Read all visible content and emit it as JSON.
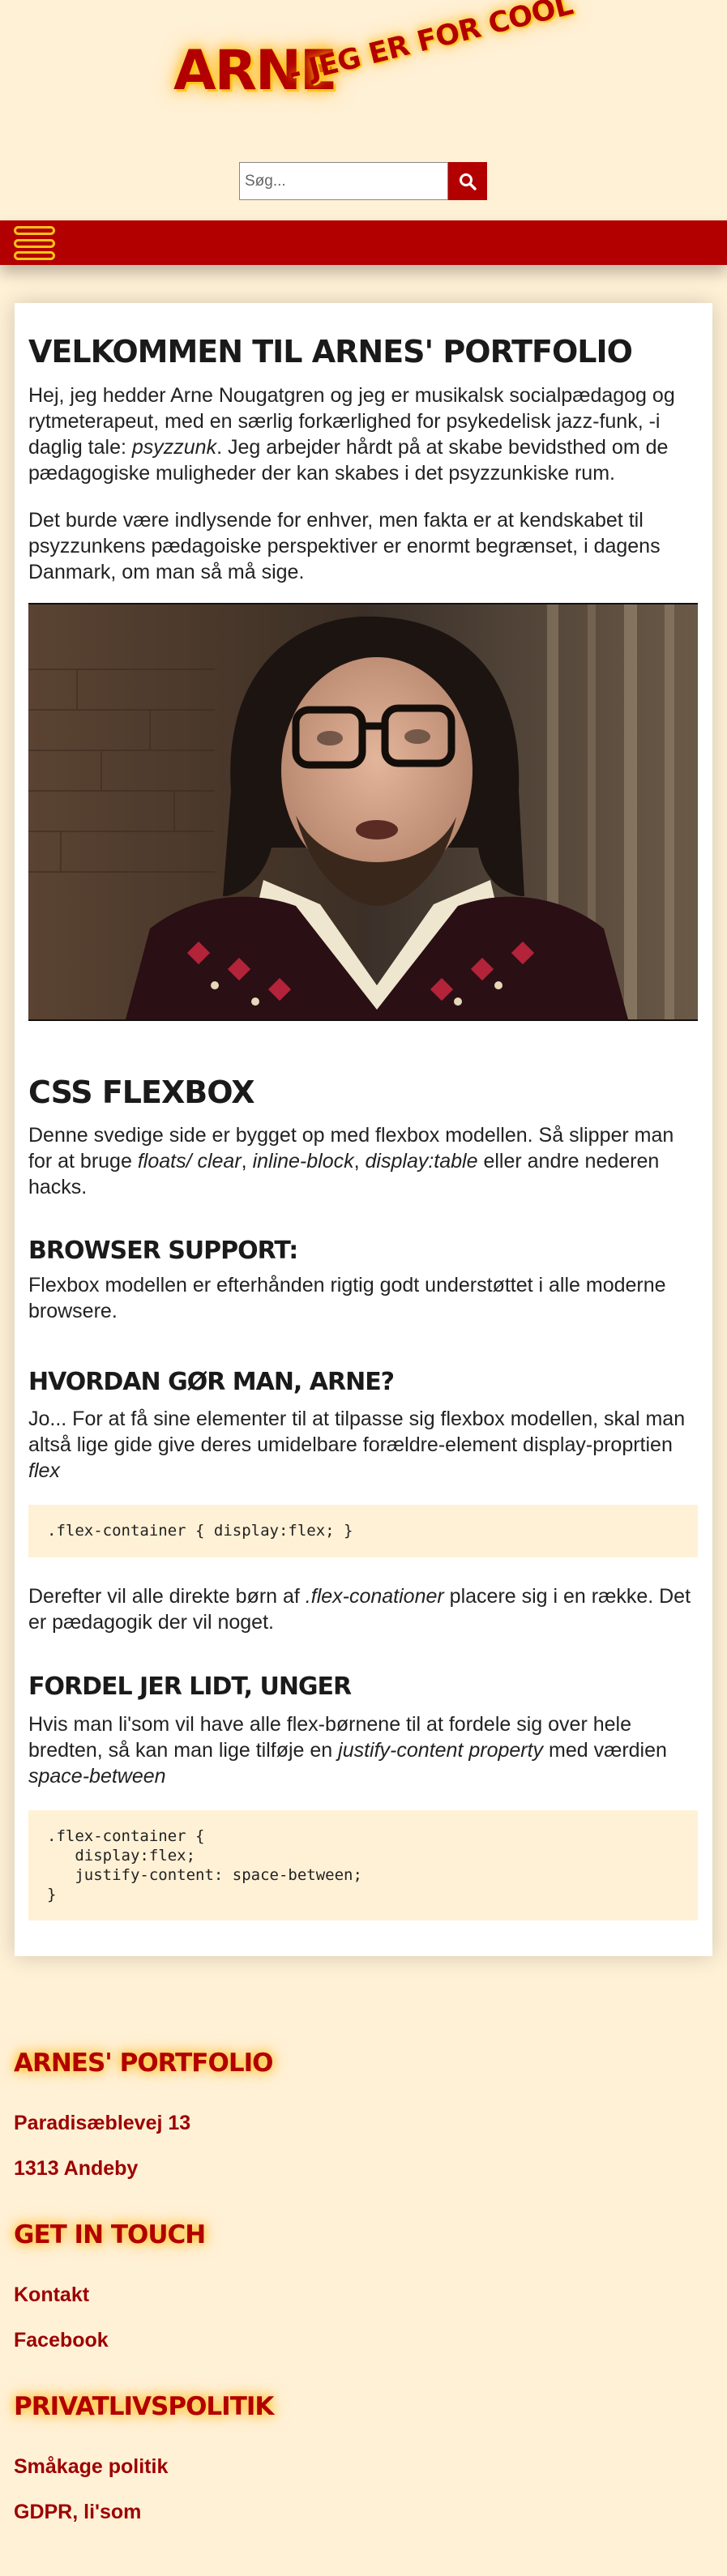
{
  "header": {
    "logo_main": "ARNE",
    "logo_sub": "- JEG ER FOR COOL",
    "search_placeholder": "Søg..."
  },
  "icons": {
    "search": "search-icon",
    "menu": "hamburger-menu-icon"
  },
  "colors": {
    "brand_red": "#b20000",
    "background_cream": "#fff1d6",
    "glow_yellow": "#ffc21a"
  },
  "main": {
    "title": "VELKOMMEN TIL ARNES' PORTFOLIO",
    "intro_p1_a": "Hej, jeg hedder Arne Nougatgren og jeg er musikalsk socialpædagog og rytmeterapeut, med en særlig forkærlighed for psykedelisk jazz-funk, -i daglig tale: ",
    "intro_p1_em": "psyzzunk",
    "intro_p1_b": ". Jeg arbejder hårdt på at skabe bevidsthed om de pædagogiske muligheder der kan skabes i det psyzzunkiske rum.",
    "intro_p2": "Det burde være indlysende for enhver, men fakta er at kendskabet til psyzzunkens pædagoiske perspektiver er enormt begrænset, i dagens Danmark, om man så må sige.",
    "flexbox_title": "CSS FLEXBOX",
    "flexbox_p_a": "Denne svedige side er bygget op med flexbox modellen. Så slipper man for at bruge ",
    "flexbox_p_em1": "floats/ clear",
    "flexbox_p_sep1": ", ",
    "flexbox_p_em2": "inline-block",
    "flexbox_p_sep2": ", ",
    "flexbox_p_em3": "display:table",
    "flexbox_p_b": " eller andre nederen hacks.",
    "support_title": "BROWSER SUPPORT:",
    "support_p": "Flexbox modellen er efterhånden rigtig godt understøttet i alle moderne browsere.",
    "howto_title": "HVORDAN GØR MAN, ARNE?",
    "howto_p_a": "Jo... For at få sine elementer til at tilpasse sig flexbox modellen, skal man altså lige gide give deres umidelbare forældre-element display-proprtien ",
    "howto_p_em": "flex",
    "code1": ".flex-container { display:flex; }",
    "after_p_a": "Derefter vil alle direkte børn af ",
    "after_p_em": ".flex-conationer",
    "after_p_b": " placere sig i en række. Det er pædagogik der vil noget.",
    "distribute_title": "FORDEL JER LIDT, UNGER",
    "distribute_p_a": "Hvis man li'som vil have alle flex-børnene til at fordele sig over hele bredten, så kan man lige tilføje en ",
    "distribute_p_em1": "justify-content property",
    "distribute_p_b": " med værdien ",
    "distribute_p_em2": "space-between",
    "code2": [
      ".flex-container {",
      "   display:flex;",
      "   justify-content: space-between;",
      "}"
    ]
  },
  "footer": {
    "portfolio_title": "ARNES' PORTFOLIO",
    "address_street": "Paradisæblevej 13",
    "address_city": "1313 Andeby",
    "contact_title": "GET IN TOUCH",
    "contact_link": "Kontakt",
    "facebook_link": "Facebook",
    "privacy_title": "PRIVATLIVSPOLITIK",
    "cookie_link": "Småkage politik",
    "gdpr_link": "GDPR, li'som"
  }
}
